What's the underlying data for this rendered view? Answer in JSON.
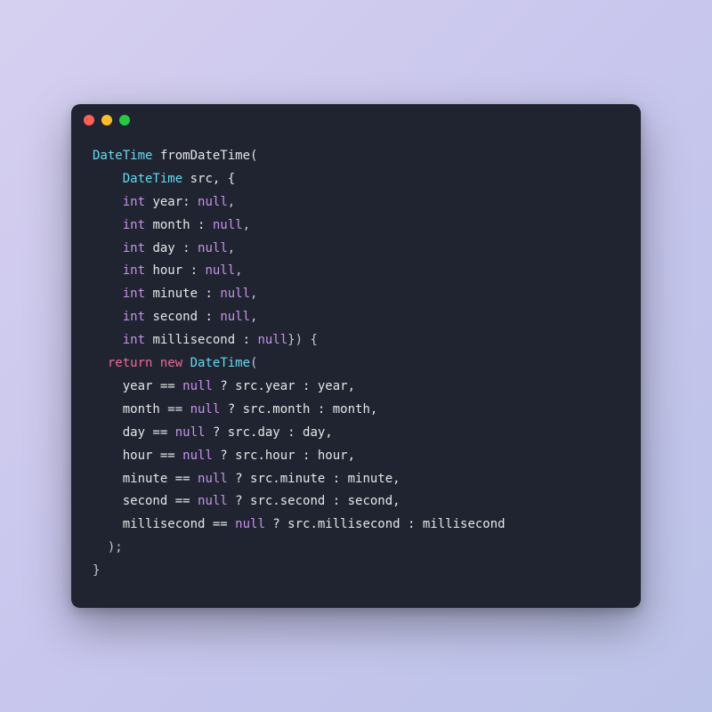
{
  "window": {
    "traffic_lights": [
      "red",
      "yellow",
      "green"
    ]
  },
  "code": {
    "lines": [
      [
        {
          "t": "type",
          "v": "DateTime"
        },
        {
          "t": "ident",
          "v": " fromDateTime("
        }
      ],
      [
        {
          "t": "ident",
          "v": "    "
        },
        {
          "t": "type",
          "v": "DateTime"
        },
        {
          "t": "ident",
          "v": " src, {"
        }
      ],
      [
        {
          "t": "ident",
          "v": "    "
        },
        {
          "t": "builtin",
          "v": "int"
        },
        {
          "t": "ident",
          "v": " year: "
        },
        {
          "t": "builtin",
          "v": "null"
        },
        {
          "t": "punct",
          "v": ","
        }
      ],
      [
        {
          "t": "ident",
          "v": "    "
        },
        {
          "t": "builtin",
          "v": "int"
        },
        {
          "t": "ident",
          "v": " month : "
        },
        {
          "t": "builtin",
          "v": "null"
        },
        {
          "t": "punct",
          "v": ","
        }
      ],
      [
        {
          "t": "ident",
          "v": "    "
        },
        {
          "t": "builtin",
          "v": "int"
        },
        {
          "t": "ident",
          "v": " day : "
        },
        {
          "t": "builtin",
          "v": "null"
        },
        {
          "t": "punct",
          "v": ","
        }
      ],
      [
        {
          "t": "ident",
          "v": "    "
        },
        {
          "t": "builtin",
          "v": "int"
        },
        {
          "t": "ident",
          "v": " hour : "
        },
        {
          "t": "builtin",
          "v": "null"
        },
        {
          "t": "punct",
          "v": ","
        }
      ],
      [
        {
          "t": "ident",
          "v": "    "
        },
        {
          "t": "builtin",
          "v": "int"
        },
        {
          "t": "ident",
          "v": " minute : "
        },
        {
          "t": "builtin",
          "v": "null"
        },
        {
          "t": "punct",
          "v": ","
        }
      ],
      [
        {
          "t": "ident",
          "v": "    "
        },
        {
          "t": "builtin",
          "v": "int"
        },
        {
          "t": "ident",
          "v": " second : "
        },
        {
          "t": "builtin",
          "v": "null"
        },
        {
          "t": "punct",
          "v": ","
        }
      ],
      [
        {
          "t": "ident",
          "v": "    "
        },
        {
          "t": "builtin",
          "v": "int"
        },
        {
          "t": "ident",
          "v": " millisecond : "
        },
        {
          "t": "builtin",
          "v": "null"
        },
        {
          "t": "punct",
          "v": "}) {"
        }
      ],
      [
        {
          "t": "ident",
          "v": "  "
        },
        {
          "t": "keyword",
          "v": "return"
        },
        {
          "t": "ident",
          "v": " "
        },
        {
          "t": "keyword",
          "v": "new"
        },
        {
          "t": "ident",
          "v": " "
        },
        {
          "t": "type",
          "v": "DateTime"
        },
        {
          "t": "punct",
          "v": "("
        }
      ],
      [
        {
          "t": "ident",
          "v": "    year == "
        },
        {
          "t": "builtin",
          "v": "null"
        },
        {
          "t": "ident",
          "v": " ? src.year : year,"
        }
      ],
      [
        {
          "t": "ident",
          "v": "    month == "
        },
        {
          "t": "builtin",
          "v": "null"
        },
        {
          "t": "ident",
          "v": " ? src.month : month,"
        }
      ],
      [
        {
          "t": "ident",
          "v": "    day == "
        },
        {
          "t": "builtin",
          "v": "null"
        },
        {
          "t": "ident",
          "v": " ? src.day : day,"
        }
      ],
      [
        {
          "t": "ident",
          "v": "    hour == "
        },
        {
          "t": "builtin",
          "v": "null"
        },
        {
          "t": "ident",
          "v": " ? src.hour : hour,"
        }
      ],
      [
        {
          "t": "ident",
          "v": "    minute == "
        },
        {
          "t": "builtin",
          "v": "null"
        },
        {
          "t": "ident",
          "v": " ? src.minute : minute,"
        }
      ],
      [
        {
          "t": "ident",
          "v": "    second == "
        },
        {
          "t": "builtin",
          "v": "null"
        },
        {
          "t": "ident",
          "v": " ? src.second : second,"
        }
      ],
      [
        {
          "t": "ident",
          "v": "    millisecond == "
        },
        {
          "t": "builtin",
          "v": "null"
        },
        {
          "t": "ident",
          "v": " ? src.millisecond : millisecond"
        }
      ],
      [
        {
          "t": "punct",
          "v": "  );"
        }
      ],
      [
        {
          "t": "punct",
          "v": "}"
        }
      ]
    ]
  }
}
